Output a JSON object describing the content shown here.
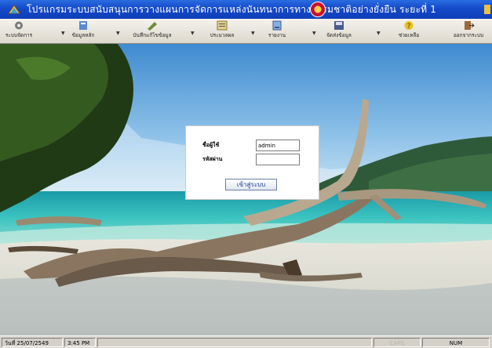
{
  "window": {
    "title": "โปรแกรมระบบสนับสนุนการวางแผนการจัดการแหล่งนันทนาการทางธรรมชาติอย่างยั่งยืน ระยะที่ 1"
  },
  "toolbar": {
    "items": [
      {
        "label": "ระบบจัดการ",
        "icon": "system-icon"
      },
      {
        "label": "ข้อมูลหลัก",
        "icon": "database-icon"
      },
      {
        "label": "บันทึกแก้ไขข้อมูล",
        "icon": "edit-icon"
      },
      {
        "label": "ประมวลผล",
        "icon": "process-icon"
      },
      {
        "label": "รายงาน",
        "icon": "report-icon"
      },
      {
        "label": "จัดส่งข้อมูล",
        "icon": "send-data-icon"
      },
      {
        "label": "ช่วยเหลือ",
        "icon": "help-icon"
      },
      {
        "label": "ออกจากระบบ",
        "icon": "exit-icon"
      }
    ]
  },
  "login": {
    "username_label": "ชื่อผู้ใช้",
    "username_value": "admin",
    "password_label": "รหัสผ่าน",
    "password_value": "",
    "submit_label": "เข้าสู่ระบบ"
  },
  "statusbar": {
    "date": "วันที่ 25/07/2549",
    "time": "3:45 PM",
    "caps": "CAPS",
    "num": "NUM"
  }
}
